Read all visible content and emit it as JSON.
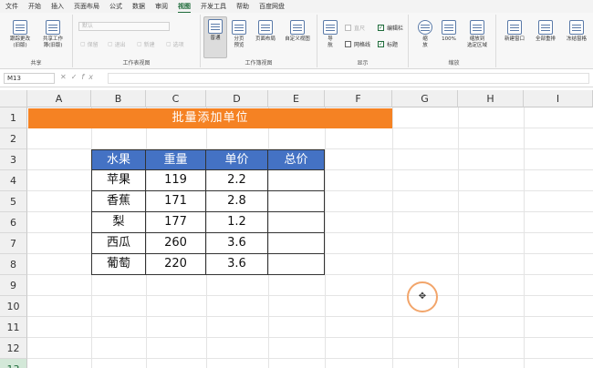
{
  "menu": {
    "tabs": [
      "文件",
      "开始",
      "插入",
      "页面布局",
      "公式",
      "数据",
      "审阅",
      "视图",
      "开发工具",
      "帮助",
      "百度网盘"
    ],
    "active": "视图"
  },
  "ribbon": {
    "share_group": {
      "label": "共享",
      "track_changes": "跟踪更改\n(旧版)",
      "share_workbook": "共享工作\n簿(旧版)"
    },
    "sheet_view_group": {
      "label": "工作表视图",
      "dropdown": "默认",
      "keep": "保留",
      "exit": "退出",
      "new": "新建",
      "options": "选项"
    },
    "workbook_views_group": {
      "label": "工作簿视图",
      "normal": "普通",
      "page_break": "分页\n预览",
      "page_layout": "页面布局",
      "custom_views": "自定义视图"
    },
    "show_group": {
      "label": "显示",
      "navigation": "导\n航",
      "ruler": "直尺",
      "formula_bar": "编辑栏",
      "gridlines": "网格线",
      "headings": "标题"
    },
    "zoom_group": {
      "label": "缩放",
      "zoom": "缩\n放",
      "zoom100": "100%",
      "zoom_selection": "缩放到\n选定区域"
    },
    "window_group": {
      "new_window": "新建窗口",
      "arrange_all": "全部重排",
      "freeze_panes": "冻结窗格"
    }
  },
  "formula_bar": {
    "name_box": "M13",
    "fx": "fx",
    "cancel": "✕",
    "enter": "✓"
  },
  "grid": {
    "columns": [
      "A",
      "B",
      "C",
      "D",
      "E",
      "F",
      "G",
      "H",
      "I"
    ],
    "rows": [
      "1",
      "2",
      "3",
      "4",
      "5",
      "6",
      "7",
      "8",
      "9",
      "10",
      "11",
      "12",
      "13"
    ],
    "title": "批量添加单位",
    "table": {
      "headers": [
        "水果",
        "重量",
        "单价",
        "总价"
      ],
      "rows": [
        [
          "苹果",
          "119",
          "2.2",
          ""
        ],
        [
          "香蕉",
          "171",
          "2.8",
          ""
        ],
        [
          "梨",
          "177",
          "1.2",
          ""
        ],
        [
          "西瓜",
          "260",
          "3.6",
          ""
        ],
        [
          "葡萄",
          "220",
          "3.6",
          ""
        ]
      ]
    }
  },
  "colors": {
    "banner": "#f58223",
    "header_fill": "#4472c4",
    "accent": "#1e6b3a"
  }
}
